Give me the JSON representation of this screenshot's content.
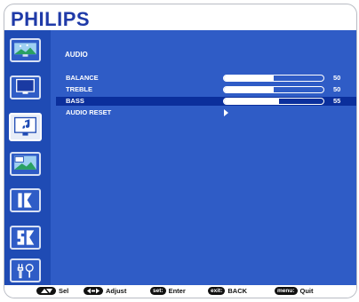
{
  "brand": "PHILIPS",
  "page_title": "AUDIO",
  "sidebar": {
    "items": [
      {
        "icon": "picture-icon"
      },
      {
        "icon": "screen-icon"
      },
      {
        "icon": "audio-icon",
        "active": true
      },
      {
        "icon": "pip-icon"
      },
      {
        "icon": "configuration1-icon"
      },
      {
        "icon": "configuration2-icon"
      },
      {
        "icon": "advanced-option-icon"
      }
    ]
  },
  "rows": [
    {
      "label": "BALANCE",
      "value": "50",
      "level": 0.5
    },
    {
      "label": "TREBLE",
      "value": "50",
      "level": 0.5
    },
    {
      "label": "BASS",
      "value": "55",
      "level": 0.55,
      "selected": true
    },
    {
      "label": "AUDIO RESET",
      "arrow": true
    }
  ],
  "footer": {
    "sel_label": "Sel",
    "adjust_label": "Adjust",
    "set_key": "set:",
    "set_label": "Enter",
    "exit_key": "exit:",
    "exit_label": "BACK",
    "menu_key": "menu:",
    "menu_label": "Quit"
  },
  "colors": {
    "brand": "#1f3aa8",
    "menu_bg": "#2f5cc6",
    "sidebar_bg": "#1f4bb4",
    "selected_row": "#0b2f9c"
  }
}
